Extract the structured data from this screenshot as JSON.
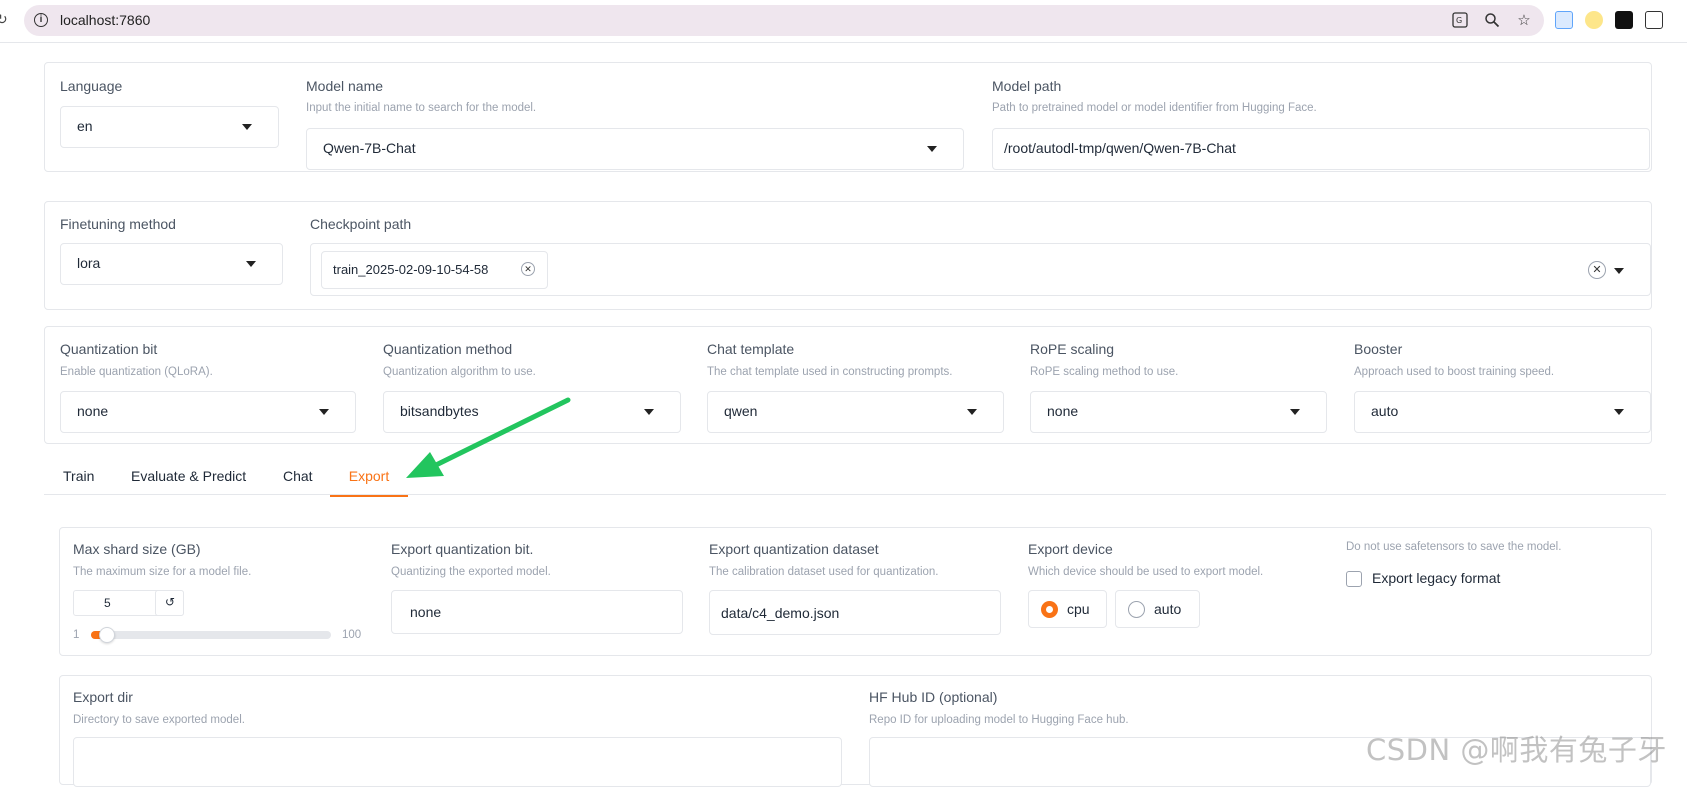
{
  "browser": {
    "url": "localhost:7860"
  },
  "top_row": {
    "language": {
      "label": "Language",
      "value": "en"
    },
    "model_name": {
      "label": "Model name",
      "info": "Input the initial name to search for the model.",
      "value": "Qwen-7B-Chat"
    },
    "model_path": {
      "label": "Model path",
      "info": "Path to pretrained model or model identifier from Hugging Face.",
      "value": "/root/autodl-tmp/qwen/Qwen-7B-Chat"
    }
  },
  "second_row": {
    "finetuning_method": {
      "label": "Finetuning method",
      "value": "lora"
    },
    "checkpoint_path": {
      "label": "Checkpoint path",
      "chips": [
        "train_2025-02-09-10-54-58"
      ]
    }
  },
  "third_row": {
    "quantization_bit": {
      "label": "Quantization bit",
      "info": "Enable quantization (QLoRA).",
      "value": "none"
    },
    "quantization_method": {
      "label": "Quantization method",
      "info": "Quantization algorithm to use.",
      "value": "bitsandbytes"
    },
    "chat_template": {
      "label": "Chat template",
      "info": "The chat template used in constructing prompts.",
      "value": "qwen"
    },
    "rope_scaling": {
      "label": "RoPE scaling",
      "info": "RoPE scaling method to use.",
      "value": "none"
    },
    "booster": {
      "label": "Booster",
      "info": "Approach used to boost training speed.",
      "value": "auto"
    }
  },
  "tabs": [
    {
      "label": "Train",
      "active": false
    },
    {
      "label": "Evaluate & Predict",
      "active": false
    },
    {
      "label": "Chat",
      "active": false
    },
    {
      "label": "Export",
      "active": true
    }
  ],
  "export": {
    "max_shard_size": {
      "label": "Max shard size (GB)",
      "info": "The maximum size for a model file.",
      "value": "5",
      "min": "1",
      "max": "100",
      "level": 0.04
    },
    "export_quantization_bit": {
      "label": "Export quantization bit.",
      "info": "Quantizing the exported model.",
      "value": "none"
    },
    "export_quantization_dataset": {
      "label": "Export quantization dataset",
      "info": "The calibration dataset used for quantization.",
      "value": "data/c4_demo.json"
    },
    "export_device": {
      "label": "Export device",
      "info": "Which device should be used to export model.",
      "options": [
        "cpu",
        "auto"
      ],
      "selected": "cpu"
    },
    "legacy": {
      "info": "Do not use safetensors to save the model.",
      "label": "Export legacy format",
      "checked": false
    },
    "export_dir": {
      "label": "Export dir",
      "info": "Directory to save exported model.",
      "value": ""
    },
    "hf_hub_id": {
      "label": "HF Hub ID (optional)",
      "info": "Repo ID for uploading model to Hugging Face hub.",
      "value": ""
    }
  },
  "colors": {
    "accent": "#f97316",
    "arrow": "#22c55e"
  },
  "watermark": "CSDN @啊我有兔子牙"
}
